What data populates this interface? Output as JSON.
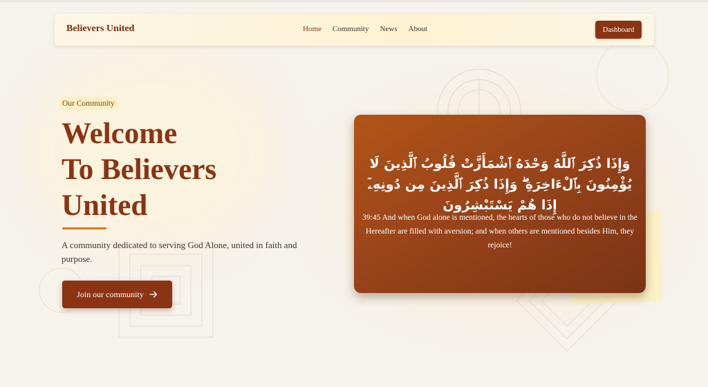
{
  "navbar": {
    "brand": "Believers United",
    "links": [
      {
        "label": "Home",
        "active": true
      },
      {
        "label": "Community",
        "active": false
      },
      {
        "label": "News",
        "active": false
      },
      {
        "label": "About",
        "active": false
      }
    ],
    "dashboard_label": "Dashboard"
  },
  "hero": {
    "tag": "Our Community",
    "title_lines": [
      "Welcome",
      "To Believers",
      "United"
    ],
    "description": "A community dedicated to serving God Alone, united in faith and purpose.",
    "cta_label": "Join our community",
    "cta_icon": "arrow-right-icon"
  },
  "quote": {
    "arabic": "وَإِذَا ذُكِرَ ٱللَّهُ وَحْدَهُ ٱشْمَأَزَّتْ قُلُوبُ ٱلَّذِينَ لَا يُؤْمِنُونَ بِٱلْءَاخِرَةِ ۖ وَإِذَا ذُكِرَ ٱلَّذِينَ مِن دُونِهِۦٓ إِذَا هُمْ يَسْتَبْشِرُونَ",
    "translation": "39:45 And when God alone is mentioned, the hearts of those who do not believe in the Hereafter are filled with aversion; and when others are mentioned besides Him, they rejoice!"
  },
  "colors": {
    "brand": "#8a3413",
    "accent": "#d07a22",
    "tag_bg": "#fbefc4",
    "background": "#f6f2ec"
  }
}
